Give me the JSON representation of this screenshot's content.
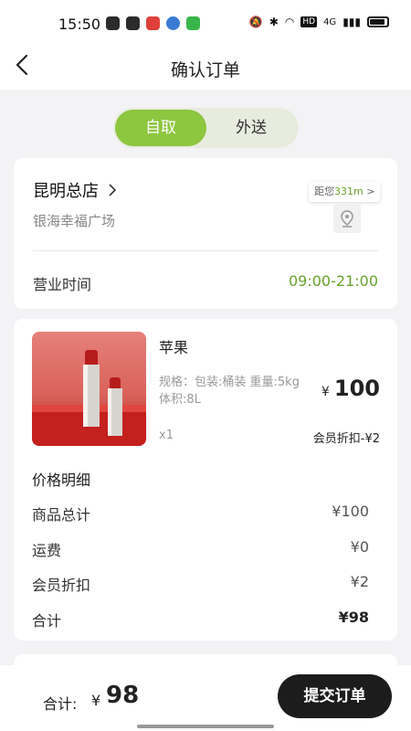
{
  "status_bar": {
    "time": "15:50",
    "indicators": [
      "notification-icon",
      "notification-icon",
      "notification-icon",
      "notification-icon",
      "notification-icon"
    ],
    "system": [
      "bluetooth-icon",
      "wifi-icon",
      "hd-icon",
      "signal-icon",
      "battery-icon"
    ],
    "network": "4G",
    "hd": "HD"
  },
  "header": {
    "title": "确认订单",
    "back_icon": "chevron-left-icon"
  },
  "delivery_tabs": [
    {
      "label": "自取",
      "active": true
    },
    {
      "label": "外送",
      "active": false
    }
  ],
  "store": {
    "name": "昆明总店",
    "address": "银海幸福广场",
    "distance_prefix": "距您",
    "distance_value": "331m",
    "distance_suffix": ">",
    "hours_label": "营业时间",
    "hours_value": "09:00-21:00",
    "location_icon": "map-pin-icon"
  },
  "product": {
    "name": "苹果",
    "spec_line1": "规格：包装:桶装 重量:5kg",
    "spec_line2": "体积:8L",
    "price_symbol": "¥",
    "price": "100",
    "quantity": "x1",
    "member_discount": "会员折扣-¥2"
  },
  "price_detail": {
    "title": "价格明细",
    "rows": [
      {
        "label": "商品总计",
        "value": "¥100"
      },
      {
        "label": "运费",
        "value": "¥0"
      },
      {
        "label": "会员折扣",
        "value": "¥2"
      },
      {
        "label": "合计",
        "value": "¥98"
      }
    ]
  },
  "bottom_bar": {
    "total_label": "合计:",
    "total_symbol": "¥",
    "total_amount": "98",
    "submit_label": "提交订单"
  },
  "colors": {
    "accent": "#8dc63f",
    "accent_text": "#6aa12a",
    "button_dark": "#1c1c1c",
    "background": "#f3f3f5"
  }
}
